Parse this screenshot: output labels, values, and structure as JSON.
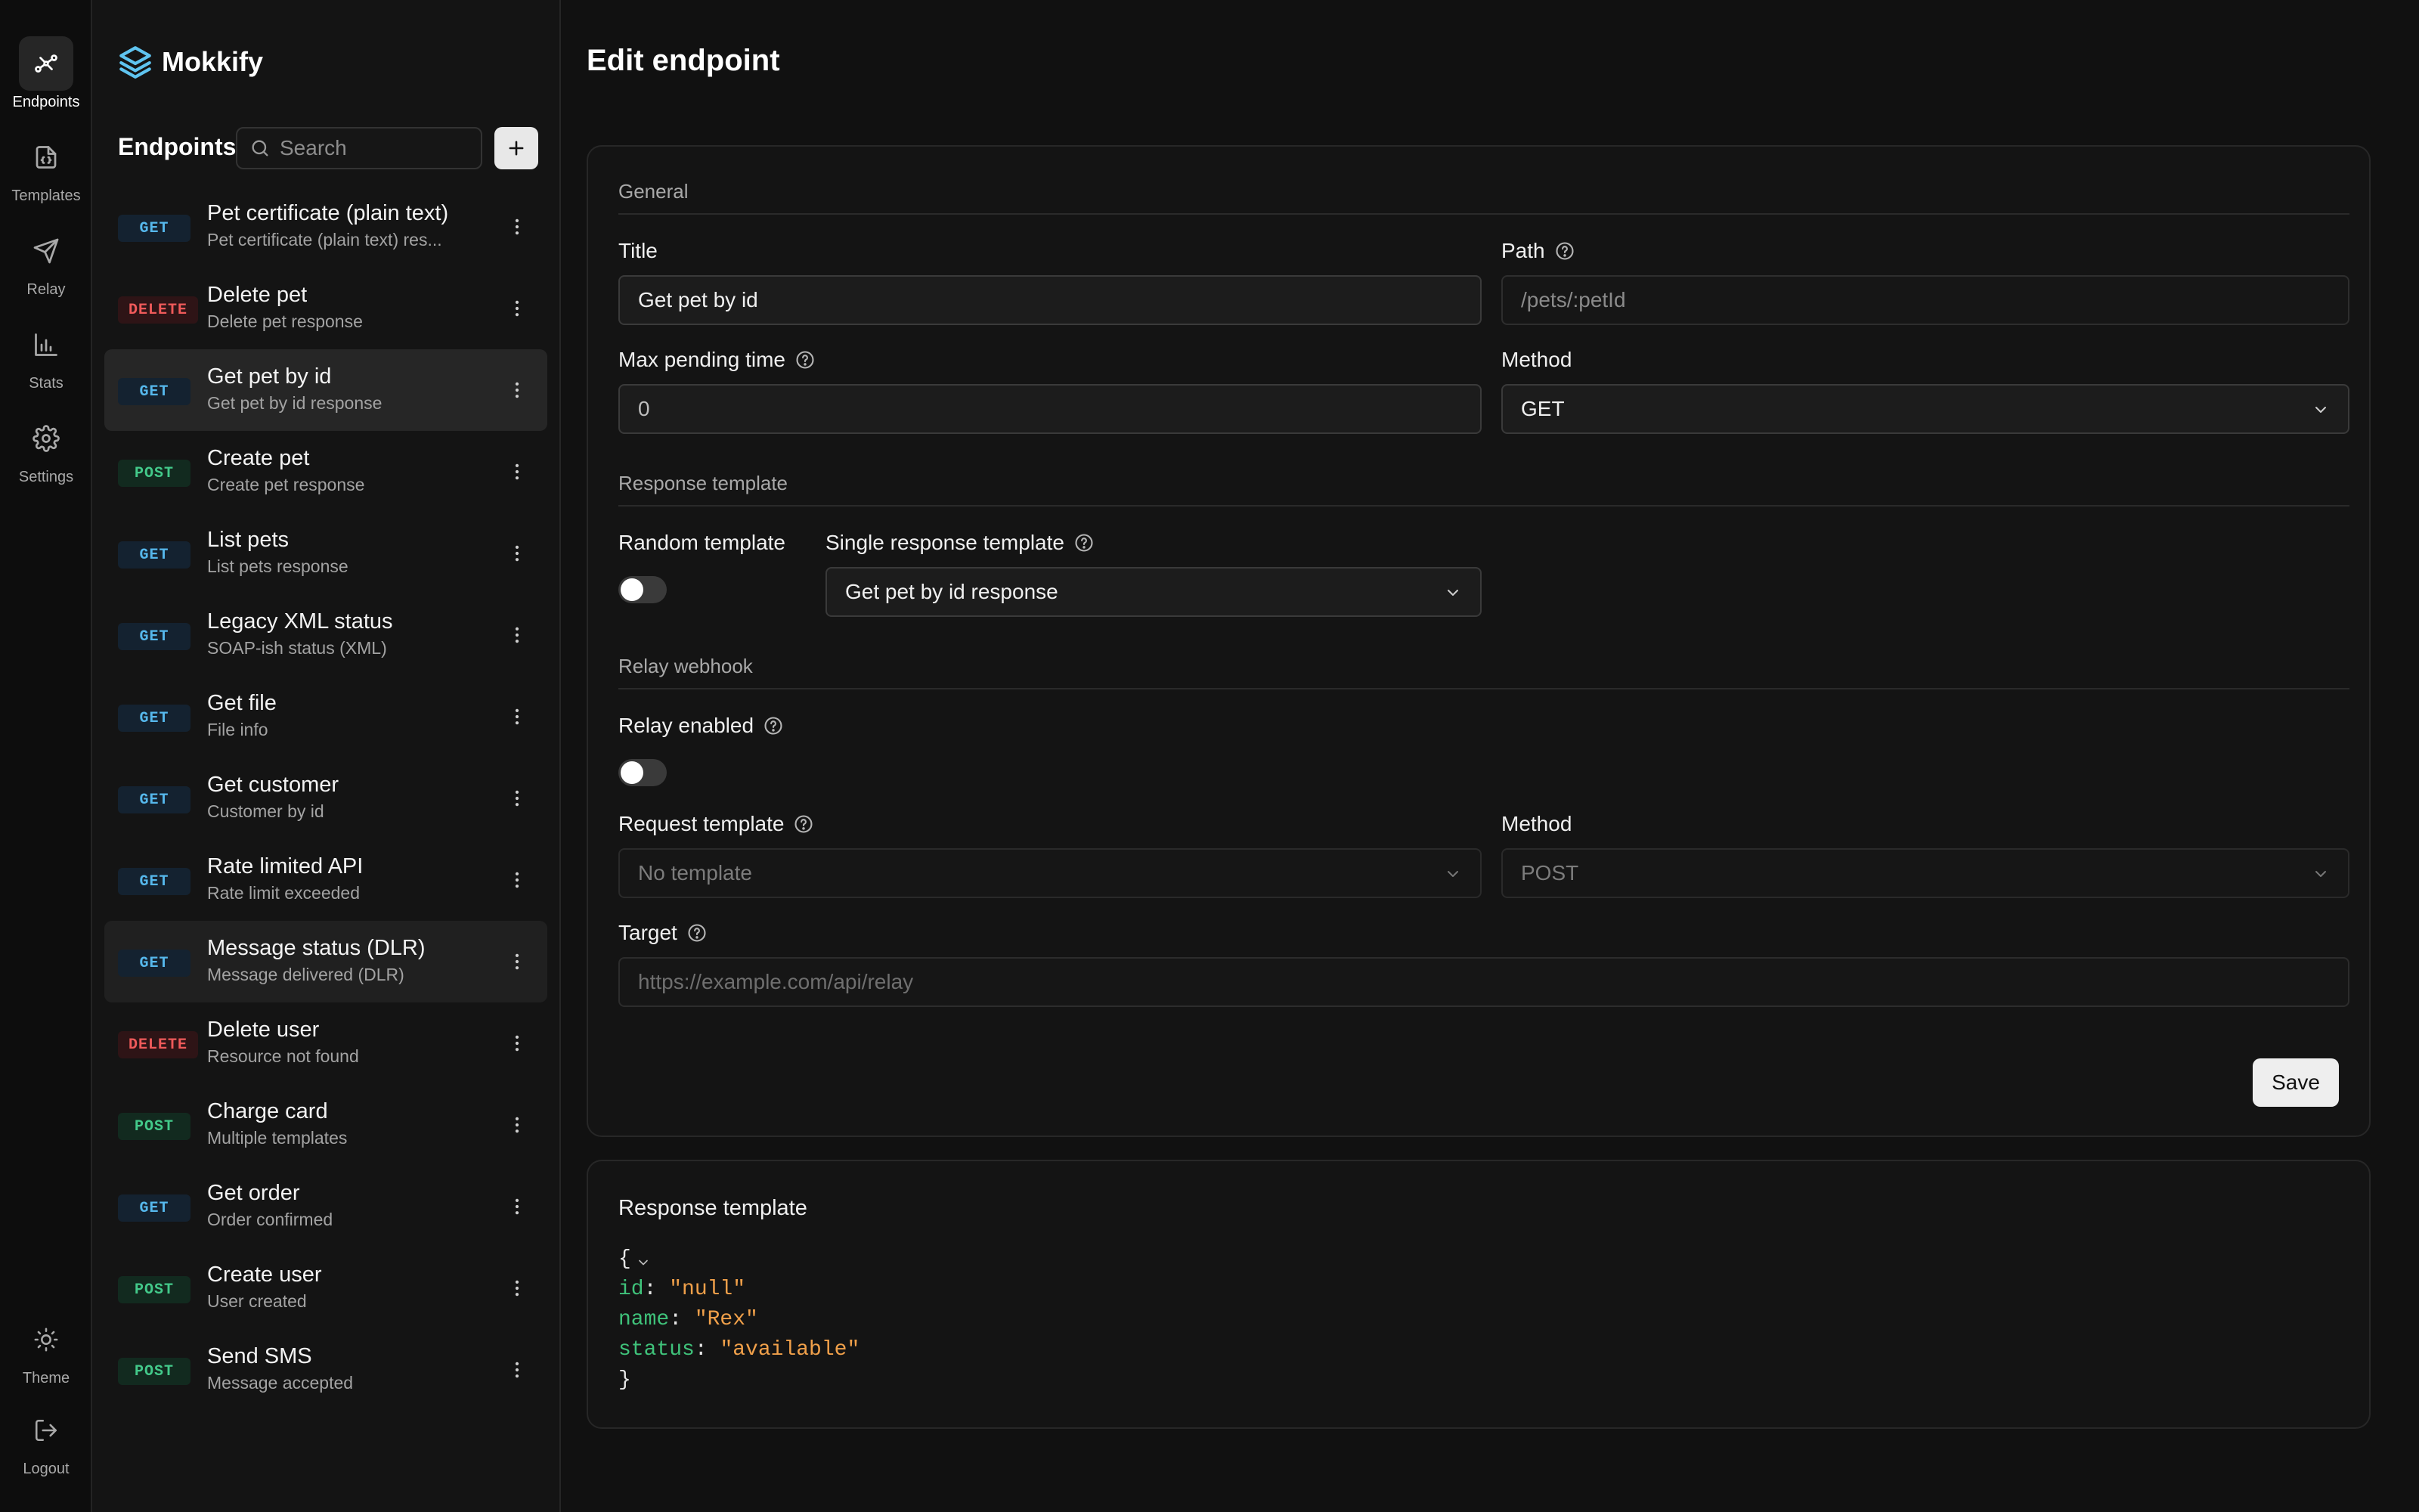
{
  "rail": {
    "items": [
      {
        "label": "Endpoints",
        "icon": "endpoints-icon"
      },
      {
        "label": "Templates",
        "icon": "templates-icon"
      },
      {
        "label": "Relay",
        "icon": "relay-icon"
      },
      {
        "label": "Stats",
        "icon": "stats-icon"
      },
      {
        "label": "Settings",
        "icon": "settings-icon"
      }
    ],
    "theme_label": "Theme",
    "logout_label": "Logout"
  },
  "brand": {
    "name": "Mokkify",
    "accent": "#5fc4f0"
  },
  "sidebar": {
    "title": "Endpoints",
    "search_placeholder": "Search",
    "add_icon": "plus-icon",
    "endpoints": [
      {
        "method": "GET",
        "title": "Pet certificate (plain text)",
        "subtitle": "Pet certificate (plain text) res..."
      },
      {
        "method": "DELETE",
        "title": "Delete pet",
        "subtitle": "Delete pet response"
      },
      {
        "method": "GET",
        "title": "Get pet by id",
        "subtitle": "Get pet by id response"
      },
      {
        "method": "POST",
        "title": "Create pet",
        "subtitle": "Create pet response"
      },
      {
        "method": "GET",
        "title": "List pets",
        "subtitle": "List pets response"
      },
      {
        "method": "GET",
        "title": "Legacy XML status",
        "subtitle": "SOAP-ish status (XML)"
      },
      {
        "method": "GET",
        "title": "Get file",
        "subtitle": "File info"
      },
      {
        "method": "GET",
        "title": "Get customer",
        "subtitle": "Customer by id"
      },
      {
        "method": "GET",
        "title": "Rate limited API",
        "subtitle": "Rate limit exceeded"
      },
      {
        "method": "GET",
        "title": "Message status (DLR)",
        "subtitle": "Message delivered (DLR)"
      },
      {
        "method": "DELETE",
        "title": "Delete user",
        "subtitle": "Resource not found"
      },
      {
        "method": "POST",
        "title": "Charge card",
        "subtitle": "Multiple templates"
      },
      {
        "method": "GET",
        "title": "Get order",
        "subtitle": "Order confirmed"
      },
      {
        "method": "POST",
        "title": "Create user",
        "subtitle": "User created"
      },
      {
        "method": "POST",
        "title": "Send SMS",
        "subtitle": "Message accepted"
      }
    ]
  },
  "main": {
    "page_title": "Edit endpoint",
    "general": {
      "section": "General",
      "title_label": "Title",
      "title_value": "Get pet by id",
      "path_label": "Path",
      "path_value": "/pets/:petId",
      "max_pending_label": "Max pending time",
      "max_pending_value": "0",
      "method_label": "Method",
      "method_value": "GET"
    },
    "response": {
      "section": "Response template",
      "random_label": "Random template",
      "random_enabled": false,
      "single_label": "Single response template",
      "single_value": "Get pet by id response"
    },
    "relay": {
      "section": "Relay webhook",
      "enabled_label": "Relay enabled",
      "enabled": false,
      "request_template_label": "Request template",
      "request_template_value": "No template",
      "method_label": "Method",
      "method_value": "POST",
      "target_label": "Target",
      "target_placeholder": "https://example.com/api/relay"
    },
    "save_label": "Save",
    "preview": {
      "title": "Response template",
      "open_brace": "{",
      "close_brace": "}",
      "fields": [
        {
          "key": "id",
          "value": "\"null\""
        },
        {
          "key": "name",
          "value": "\"Rex\""
        },
        {
          "key": "status",
          "value": "\"available\""
        }
      ]
    }
  },
  "colors": {
    "get": "#56b8ec",
    "post": "#43c98a",
    "delete": "#ef5a5a",
    "json_key": "#3fc27a",
    "json_string": "#f0a04a"
  }
}
